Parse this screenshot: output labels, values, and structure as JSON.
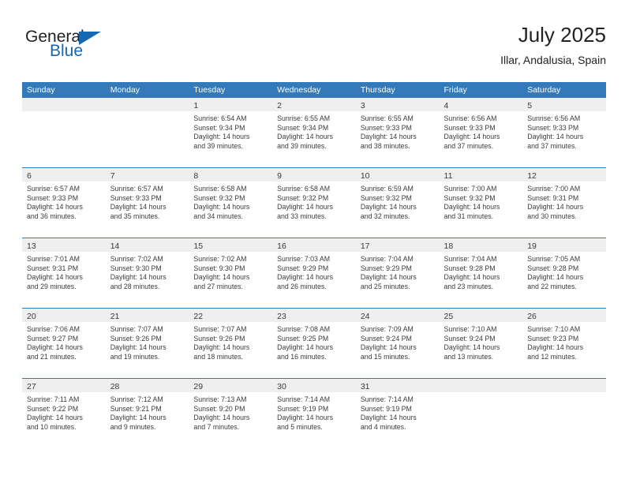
{
  "brand": {
    "name_part1": "General",
    "name_part2": "Blue",
    "triangle_color": "#1567b2"
  },
  "header": {
    "title": "July 2025",
    "subtitle": "Illar, Andalusia, Spain"
  },
  "theme": {
    "header_blue": "#3479b9",
    "day_band_gray": "#efefef",
    "text": "#3b3b3b"
  },
  "weekdays": [
    "Sunday",
    "Monday",
    "Tuesday",
    "Wednesday",
    "Thursday",
    "Friday",
    "Saturday"
  ],
  "weeks": [
    [
      {
        "day": "",
        "empty": true,
        "sunrise": "",
        "sunset": "",
        "daylight1": "",
        "daylight2": ""
      },
      {
        "day": "",
        "empty": true,
        "sunrise": "",
        "sunset": "",
        "daylight1": "",
        "daylight2": ""
      },
      {
        "day": "1",
        "empty": false,
        "sunrise": "Sunrise: 6:54 AM",
        "sunset": "Sunset: 9:34 PM",
        "daylight1": "Daylight: 14 hours",
        "daylight2": "and 39 minutes."
      },
      {
        "day": "2",
        "empty": false,
        "sunrise": "Sunrise: 6:55 AM",
        "sunset": "Sunset: 9:34 PM",
        "daylight1": "Daylight: 14 hours",
        "daylight2": "and 39 minutes."
      },
      {
        "day": "3",
        "empty": false,
        "sunrise": "Sunrise: 6:55 AM",
        "sunset": "Sunset: 9:33 PM",
        "daylight1": "Daylight: 14 hours",
        "daylight2": "and 38 minutes."
      },
      {
        "day": "4",
        "empty": false,
        "sunrise": "Sunrise: 6:56 AM",
        "sunset": "Sunset: 9:33 PM",
        "daylight1": "Daylight: 14 hours",
        "daylight2": "and 37 minutes."
      },
      {
        "day": "5",
        "empty": false,
        "sunrise": "Sunrise: 6:56 AM",
        "sunset": "Sunset: 9:33 PM",
        "daylight1": "Daylight: 14 hours",
        "daylight2": "and 37 minutes."
      }
    ],
    [
      {
        "day": "6",
        "empty": false,
        "sunrise": "Sunrise: 6:57 AM",
        "sunset": "Sunset: 9:33 PM",
        "daylight1": "Daylight: 14 hours",
        "daylight2": "and 36 minutes."
      },
      {
        "day": "7",
        "empty": false,
        "sunrise": "Sunrise: 6:57 AM",
        "sunset": "Sunset: 9:33 PM",
        "daylight1": "Daylight: 14 hours",
        "daylight2": "and 35 minutes."
      },
      {
        "day": "8",
        "empty": false,
        "sunrise": "Sunrise: 6:58 AM",
        "sunset": "Sunset: 9:32 PM",
        "daylight1": "Daylight: 14 hours",
        "daylight2": "and 34 minutes."
      },
      {
        "day": "9",
        "empty": false,
        "sunrise": "Sunrise: 6:58 AM",
        "sunset": "Sunset: 9:32 PM",
        "daylight1": "Daylight: 14 hours",
        "daylight2": "and 33 minutes."
      },
      {
        "day": "10",
        "empty": false,
        "sunrise": "Sunrise: 6:59 AM",
        "sunset": "Sunset: 9:32 PM",
        "daylight1": "Daylight: 14 hours",
        "daylight2": "and 32 minutes."
      },
      {
        "day": "11",
        "empty": false,
        "sunrise": "Sunrise: 7:00 AM",
        "sunset": "Sunset: 9:32 PM",
        "daylight1": "Daylight: 14 hours",
        "daylight2": "and 31 minutes."
      },
      {
        "day": "12",
        "empty": false,
        "sunrise": "Sunrise: 7:00 AM",
        "sunset": "Sunset: 9:31 PM",
        "daylight1": "Daylight: 14 hours",
        "daylight2": "and 30 minutes."
      }
    ],
    [
      {
        "day": "13",
        "empty": false,
        "sunrise": "Sunrise: 7:01 AM",
        "sunset": "Sunset: 9:31 PM",
        "daylight1": "Daylight: 14 hours",
        "daylight2": "and 29 minutes."
      },
      {
        "day": "14",
        "empty": false,
        "sunrise": "Sunrise: 7:02 AM",
        "sunset": "Sunset: 9:30 PM",
        "daylight1": "Daylight: 14 hours",
        "daylight2": "and 28 minutes."
      },
      {
        "day": "15",
        "empty": false,
        "sunrise": "Sunrise: 7:02 AM",
        "sunset": "Sunset: 9:30 PM",
        "daylight1": "Daylight: 14 hours",
        "daylight2": "and 27 minutes."
      },
      {
        "day": "16",
        "empty": false,
        "sunrise": "Sunrise: 7:03 AM",
        "sunset": "Sunset: 9:29 PM",
        "daylight1": "Daylight: 14 hours",
        "daylight2": "and 26 minutes."
      },
      {
        "day": "17",
        "empty": false,
        "sunrise": "Sunrise: 7:04 AM",
        "sunset": "Sunset: 9:29 PM",
        "daylight1": "Daylight: 14 hours",
        "daylight2": "and 25 minutes."
      },
      {
        "day": "18",
        "empty": false,
        "sunrise": "Sunrise: 7:04 AM",
        "sunset": "Sunset: 9:28 PM",
        "daylight1": "Daylight: 14 hours",
        "daylight2": "and 23 minutes."
      },
      {
        "day": "19",
        "empty": false,
        "sunrise": "Sunrise: 7:05 AM",
        "sunset": "Sunset: 9:28 PM",
        "daylight1": "Daylight: 14 hours",
        "daylight2": "and 22 minutes."
      }
    ],
    [
      {
        "day": "20",
        "empty": false,
        "sunrise": "Sunrise: 7:06 AM",
        "sunset": "Sunset: 9:27 PM",
        "daylight1": "Daylight: 14 hours",
        "daylight2": "and 21 minutes."
      },
      {
        "day": "21",
        "empty": false,
        "sunrise": "Sunrise: 7:07 AM",
        "sunset": "Sunset: 9:26 PM",
        "daylight1": "Daylight: 14 hours",
        "daylight2": "and 19 minutes."
      },
      {
        "day": "22",
        "empty": false,
        "sunrise": "Sunrise: 7:07 AM",
        "sunset": "Sunset: 9:26 PM",
        "daylight1": "Daylight: 14 hours",
        "daylight2": "and 18 minutes."
      },
      {
        "day": "23",
        "empty": false,
        "sunrise": "Sunrise: 7:08 AM",
        "sunset": "Sunset: 9:25 PM",
        "daylight1": "Daylight: 14 hours",
        "daylight2": "and 16 minutes."
      },
      {
        "day": "24",
        "empty": false,
        "sunrise": "Sunrise: 7:09 AM",
        "sunset": "Sunset: 9:24 PM",
        "daylight1": "Daylight: 14 hours",
        "daylight2": "and 15 minutes."
      },
      {
        "day": "25",
        "empty": false,
        "sunrise": "Sunrise: 7:10 AM",
        "sunset": "Sunset: 9:24 PM",
        "daylight1": "Daylight: 14 hours",
        "daylight2": "and 13 minutes."
      },
      {
        "day": "26",
        "empty": false,
        "sunrise": "Sunrise: 7:10 AM",
        "sunset": "Sunset: 9:23 PM",
        "daylight1": "Daylight: 14 hours",
        "daylight2": "and 12 minutes."
      }
    ],
    [
      {
        "day": "27",
        "empty": false,
        "sunrise": "Sunrise: 7:11 AM",
        "sunset": "Sunset: 9:22 PM",
        "daylight1": "Daylight: 14 hours",
        "daylight2": "and 10 minutes."
      },
      {
        "day": "28",
        "empty": false,
        "sunrise": "Sunrise: 7:12 AM",
        "sunset": "Sunset: 9:21 PM",
        "daylight1": "Daylight: 14 hours",
        "daylight2": "and 9 minutes."
      },
      {
        "day": "29",
        "empty": false,
        "sunrise": "Sunrise: 7:13 AM",
        "sunset": "Sunset: 9:20 PM",
        "daylight1": "Daylight: 14 hours",
        "daylight2": "and 7 minutes."
      },
      {
        "day": "30",
        "empty": false,
        "sunrise": "Sunrise: 7:14 AM",
        "sunset": "Sunset: 9:19 PM",
        "daylight1": "Daylight: 14 hours",
        "daylight2": "and 5 minutes."
      },
      {
        "day": "31",
        "empty": false,
        "sunrise": "Sunrise: 7:14 AM",
        "sunset": "Sunset: 9:19 PM",
        "daylight1": "Daylight: 14 hours",
        "daylight2": "and 4 minutes."
      },
      {
        "day": "",
        "empty": true,
        "sunrise": "",
        "sunset": "",
        "daylight1": "",
        "daylight2": ""
      },
      {
        "day": "",
        "empty": true,
        "sunrise": "",
        "sunset": "",
        "daylight1": "",
        "daylight2": ""
      }
    ]
  ]
}
